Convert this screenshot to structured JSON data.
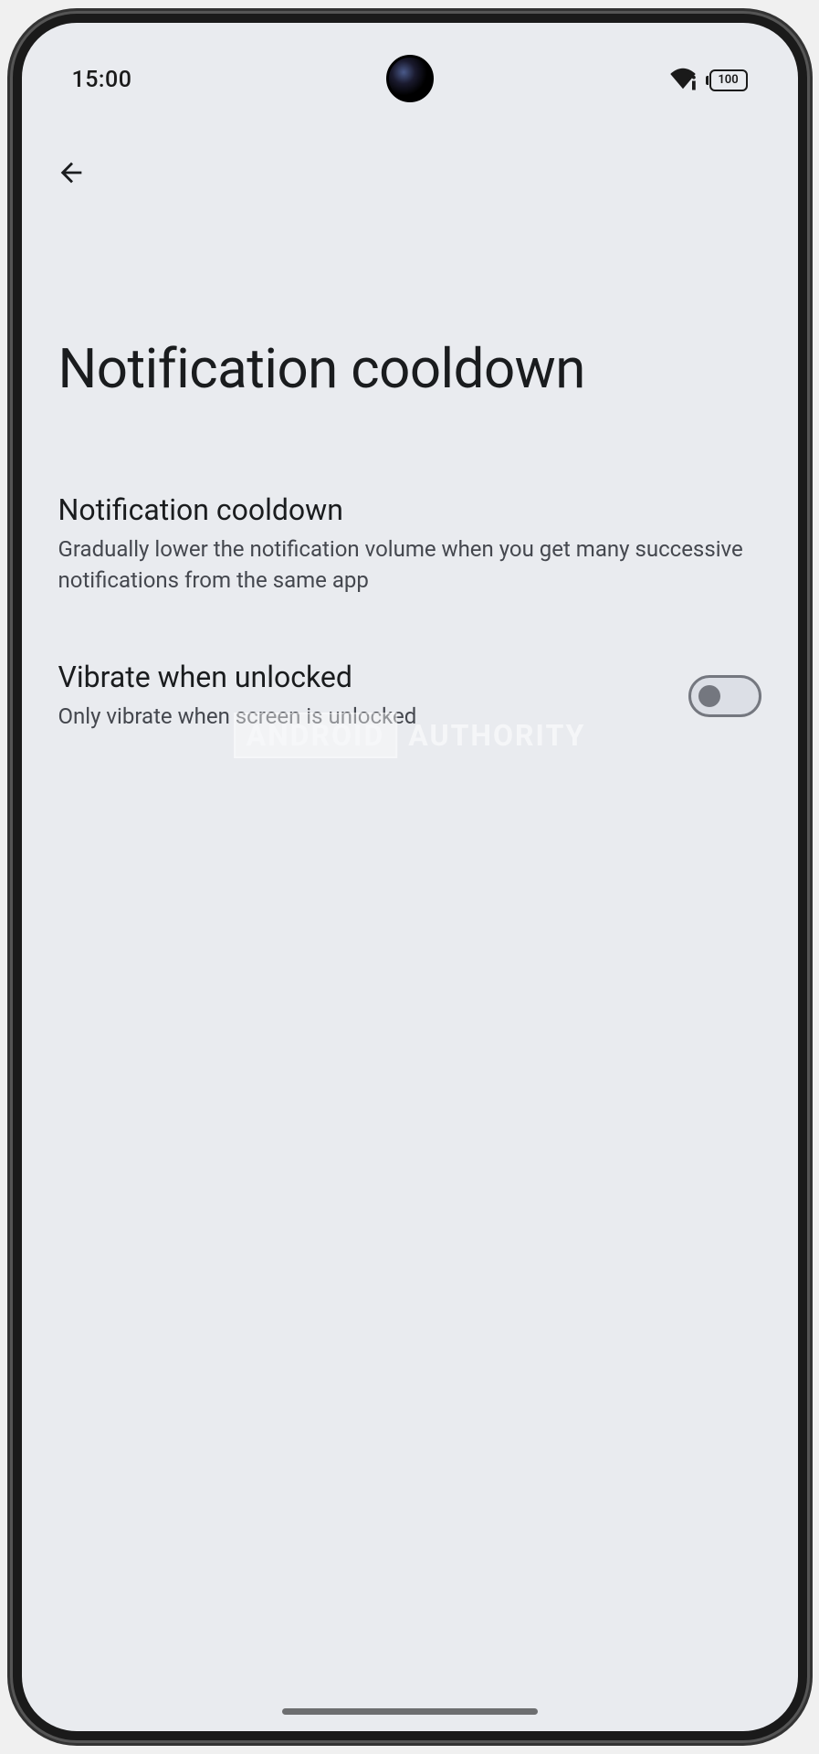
{
  "status_bar": {
    "time": "15:00",
    "battery": "100"
  },
  "page": {
    "title": "Notification cooldown"
  },
  "settings": [
    {
      "title": "Notification cooldown",
      "subtitle": "Gradually lower the notification volume when you get many successive notifications from the same app",
      "has_toggle": false
    },
    {
      "title": "Vibrate when unlocked",
      "subtitle": "Only vibrate when screen is unlocked",
      "has_toggle": true,
      "toggle_state": false
    }
  ],
  "watermark": {
    "part1": "ANDROID",
    "part2": "AUTHORITY"
  }
}
